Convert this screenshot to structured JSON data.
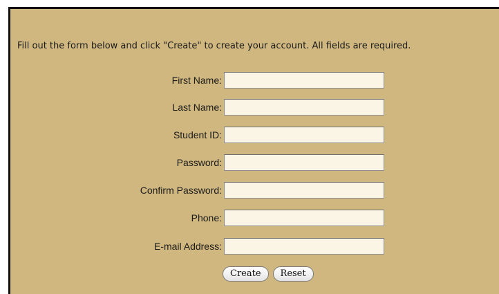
{
  "instructions": "Fill out the form below and click \"Create\" to create your account. All fields are required.",
  "form": {
    "fields": [
      {
        "label": "First Name:",
        "value": ""
      },
      {
        "label": "Last Name:",
        "value": ""
      },
      {
        "label": "Student ID:",
        "value": ""
      },
      {
        "label": "Password:",
        "value": ""
      },
      {
        "label": "Confirm Password:",
        "value": ""
      },
      {
        "label": "Phone:",
        "value": ""
      },
      {
        "label": "E-mail Address:",
        "value": ""
      }
    ],
    "create_label": "Create",
    "reset_label": "Reset"
  },
  "colors": {
    "panel_background": "#cfb77f",
    "input_background": "#fbf5e6"
  }
}
